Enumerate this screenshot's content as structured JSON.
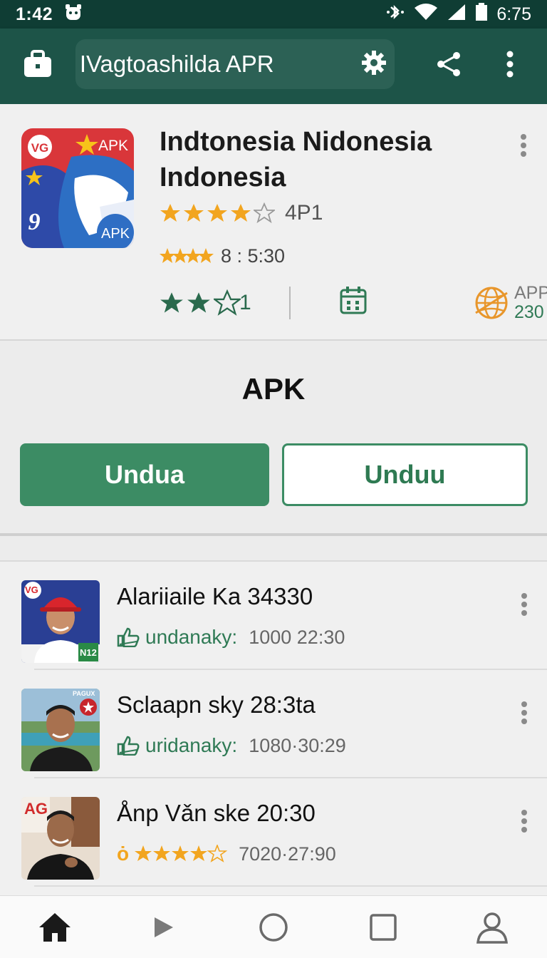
{
  "status_bar": {
    "time": "1:42",
    "right_text": "6:75"
  },
  "app_bar": {
    "search_query": "IVagtoashilda APR"
  },
  "app": {
    "title": "Indtonesia Nidonesia Indonesia",
    "icon_label_top": "APK",
    "icon_label_bottom": "APK",
    "icon_label_corner": "VG",
    "icon_label_number": "9",
    "rating_stars": 4,
    "rating_value": "4P1",
    "sub_value": "8 : 5:30",
    "review_stars_filled": 2,
    "review_count": "1",
    "app_label": "APP",
    "app_value": "230"
  },
  "apk_section": {
    "heading": "APK",
    "primary_button": "Undua",
    "secondary_button": "Unduu"
  },
  "list": [
    {
      "title": "Alariiaile Ka 34330",
      "meta_label": "undanaky:",
      "meta_value": "1000  22:30",
      "badge": "VG",
      "badge2": "N12"
    },
    {
      "title": "Sclaapn sky 28:3ta",
      "meta_label": "uridanaky:",
      "meta_value": "1080·30:29",
      "badge": "PAGUX"
    },
    {
      "title": "Ånp Vǎn ske 20:30",
      "meta_prefix": "ȯ",
      "meta_stars": 4,
      "meta_value": "7020·27:90",
      "badge": "AG"
    }
  ],
  "colors": {
    "primary": "#3c8c64",
    "app_bar": "#1d5448",
    "status_bar": "#0f3d34",
    "star": "#f2a51f"
  }
}
